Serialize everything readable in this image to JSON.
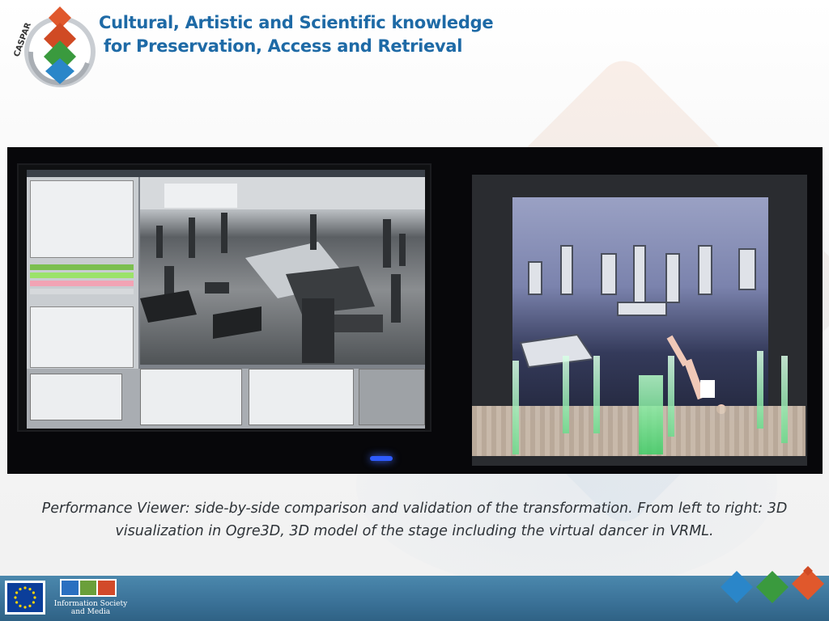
{
  "header": {
    "title_line1": "Cultural, Artistic and Scientific knowledge",
    "title_line2": "for Preservation, Access and Retrieval",
    "logo_text": "CASPAR"
  },
  "photo": {
    "description_icon": "monitors-photo"
  },
  "caption": {
    "text": "Performance Viewer: side-by-side comparison and validation of the transformation. From left to right: 3D visualization in Ogre3D, 3D model of the stage including the virtual dancer in VRML."
  },
  "footer": {
    "isoc_line1": "Information Society",
    "isoc_line2": "and Media"
  },
  "colors": {
    "title_blue": "#1e6aa6",
    "footer_blue": "#3a7197",
    "diamond_orange": "#e0582c",
    "diamond_green": "#3a9a3e",
    "diamond_blue": "#2a86c9"
  }
}
